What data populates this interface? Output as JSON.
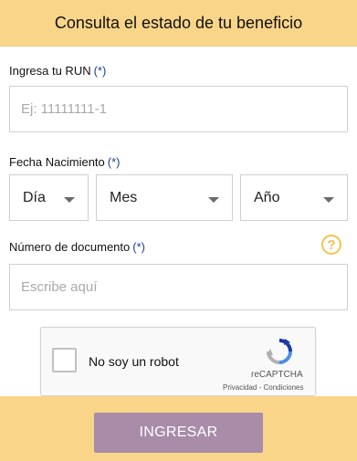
{
  "header": {
    "title": "Consulta el estado de tu beneficio"
  },
  "run": {
    "label": "Ingresa tu RUN",
    "required": "(*)",
    "placeholder": "Ej: 11111111-1"
  },
  "birth": {
    "label": "Fecha Nacimiento",
    "required": "(*)",
    "day": "Día",
    "month": "Mes",
    "year": "Año"
  },
  "document": {
    "label": "Número de documento",
    "required": "(*)",
    "placeholder": "Escribe aquí",
    "help": "?"
  },
  "captcha": {
    "checkbox_label": "No soy un robot",
    "brand": "reCAPTCHA",
    "privacy": "Privacidad",
    "separator": " - ",
    "terms": "Condiciones"
  },
  "submit": {
    "label": "INGRESAR"
  },
  "colors": {
    "header_bg": "#f9d58a",
    "button_bg": "#a88ca8",
    "required": "#1f3f8a",
    "help": "#f2c44f"
  }
}
